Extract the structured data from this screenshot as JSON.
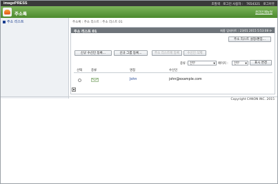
{
  "topbar": {
    "brand": "imagePRESS",
    "links": [
      "조발색",
      "로그인 사용자 :",
      "7654321",
      "로그아웃"
    ]
  },
  "app": {
    "title": "주소록",
    "help": "온라인매뉴얼"
  },
  "sidebar": {
    "items": [
      {
        "label": "주소 리스트"
      }
    ]
  },
  "breadcrumb": "주소록 : 주소 리스트 : 주소 리스트 01",
  "panel": {
    "title": "주소 리스트 01",
    "updated": "최종 업데이트 : 23/01 2015 5:53:08",
    "refresh_icon": "refresh-icon",
    "settings_button": "주소 리스트 설정/편집...",
    "buttons": {
      "new_recipient": "신규 수신인 등록...",
      "new_group": "신규 그룹 등록...",
      "add_to_list": "주소 리스트에 등록",
      "delete_recipient": "수신인 삭제"
    },
    "filters": {
      "type_label": "종류 :",
      "type_value": "전부",
      "index_label": "페이지 :",
      "index_value": "전부",
      "display_button": "표시 변경"
    },
    "columns": {
      "select": "선택",
      "type": "종류",
      "name": "명칭",
      "recipient": "수신인"
    },
    "rows": [
      {
        "type_icon": "email-type-icon",
        "name": "John",
        "email": "john@example.com"
      }
    ]
  },
  "footer": {
    "copyright": "Copyright CANON INC. 2015"
  },
  "colors": {
    "header_green": "#5c9a3a",
    "panel_header": "#6e747a",
    "link_blue": "#1a3d8f"
  }
}
